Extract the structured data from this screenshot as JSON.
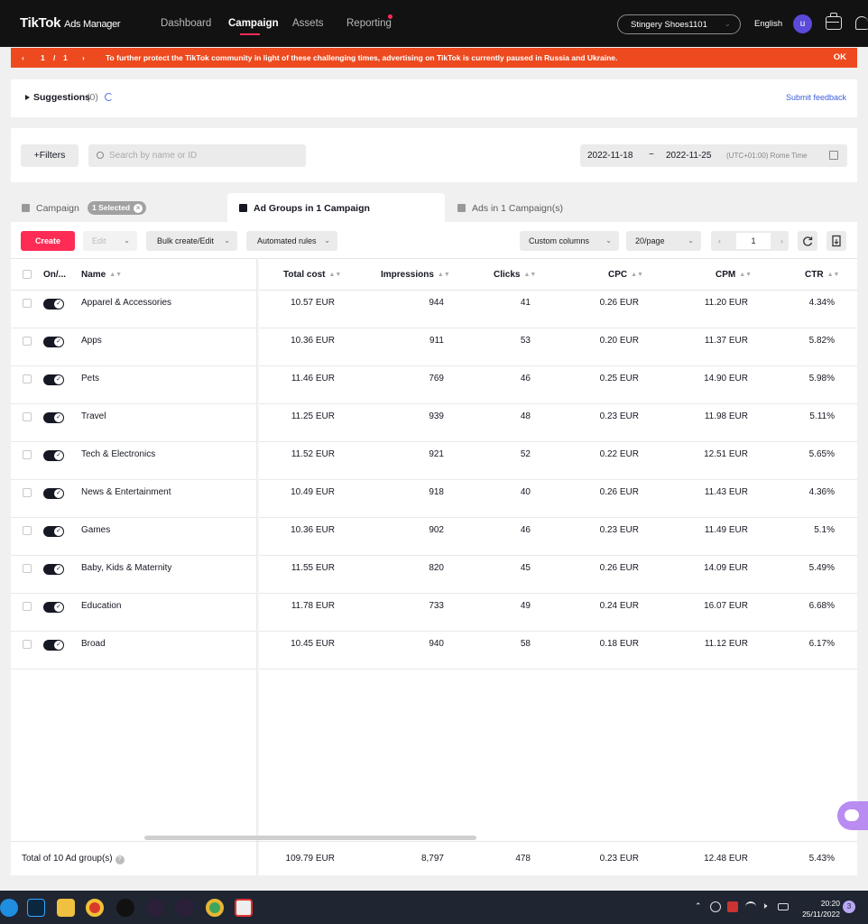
{
  "nav": {
    "logo": "TikTok",
    "logo_sub": "Ads Manager",
    "items": [
      "Dashboard",
      "Campaign",
      "Assets",
      "Reporting"
    ],
    "account": "Stingery Shoes1101",
    "language": "English",
    "avatar_letter": "u"
  },
  "banner": {
    "page_current": "1",
    "page_sep": "/",
    "page_total": "1",
    "message": "To further protect the TikTok community in light of these challenging times, advertising on TikTok is currently paused in Russia and Ukraine.",
    "ok": "OK",
    "color": "#ed4a1f"
  },
  "suggestions": {
    "label": "Suggestions",
    "count": "(0)",
    "feedback": "Submit feedback"
  },
  "filters": {
    "button": "Filters",
    "search_placeholder": "Search by name or ID",
    "date_start": "2022-11-18",
    "date_sep": "~",
    "date_end": "2022-11-25",
    "timezone": "(UTC+01:00) Rome Time"
  },
  "tabs": {
    "campaign": "Campaign",
    "selected_badge": "1 Selected",
    "ad_groups": "Ad Groups in 1 Campaign",
    "ads": "Ads in 1 Campaign(s)"
  },
  "toolbar": {
    "create": "Create",
    "edit": "Edit",
    "bulk": "Bulk create/Edit",
    "automated": "Automated rules",
    "custom_columns": "Custom columns",
    "per_page": "20/page",
    "page_number": "1"
  },
  "table": {
    "headers": [
      "On/...",
      "Name",
      "Total cost",
      "Impressions",
      "Clicks",
      "CPC",
      "CPM",
      "CTR"
    ],
    "rows": [
      {
        "name": "Apparel & Accessories",
        "cost": "10.57 EUR",
        "impressions": "944",
        "clicks": "41",
        "cpc": "0.26 EUR",
        "cpm": "11.20 EUR",
        "ctr": "4.34%"
      },
      {
        "name": "Apps",
        "cost": "10.36 EUR",
        "impressions": "911",
        "clicks": "53",
        "cpc": "0.20 EUR",
        "cpm": "11.37 EUR",
        "ctr": "5.82%"
      },
      {
        "name": "Pets",
        "cost": "11.46 EUR",
        "impressions": "769",
        "clicks": "46",
        "cpc": "0.25 EUR",
        "cpm": "14.90 EUR",
        "ctr": "5.98%"
      },
      {
        "name": "Travel",
        "cost": "11.25 EUR",
        "impressions": "939",
        "clicks": "48",
        "cpc": "0.23 EUR",
        "cpm": "11.98 EUR",
        "ctr": "5.11%"
      },
      {
        "name": "Tech & Electronics",
        "cost": "11.52 EUR",
        "impressions": "921",
        "clicks": "52",
        "cpc": "0.22 EUR",
        "cpm": "12.51 EUR",
        "ctr": "5.65%"
      },
      {
        "name": "News & Entertainment",
        "cost": "10.49 EUR",
        "impressions": "918",
        "clicks": "40",
        "cpc": "0.26 EUR",
        "cpm": "11.43 EUR",
        "ctr": "4.36%"
      },
      {
        "name": "Games",
        "cost": "10.36 EUR",
        "impressions": "902",
        "clicks": "46",
        "cpc": "0.23 EUR",
        "cpm": "11.49 EUR",
        "ctr": "5.1%"
      },
      {
        "name": "Baby, Kids & Maternity",
        "cost": "11.55 EUR",
        "impressions": "820",
        "clicks": "45",
        "cpc": "0.26 EUR",
        "cpm": "14.09 EUR",
        "ctr": "5.49%"
      },
      {
        "name": "Education",
        "cost": "11.78 EUR",
        "impressions": "733",
        "clicks": "49",
        "cpc": "0.24 EUR",
        "cpm": "16.07 EUR",
        "ctr": "6.68%"
      },
      {
        "name": "Broad",
        "cost": "10.45 EUR",
        "impressions": "940",
        "clicks": "58",
        "cpc": "0.18 EUR",
        "cpm": "11.12 EUR",
        "ctr": "6.17%"
      }
    ],
    "total": {
      "label": "Total of 10 Ad group(s)",
      "cost": "109.79 EUR",
      "impressions": "8,797",
      "clicks": "478",
      "cpc": "0.23 EUR",
      "cpm": "12.48 EUR",
      "ctr": "5.43%"
    }
  },
  "taskbar": {
    "time": "20:20",
    "date": "25/11/2022",
    "notifications": "3"
  }
}
